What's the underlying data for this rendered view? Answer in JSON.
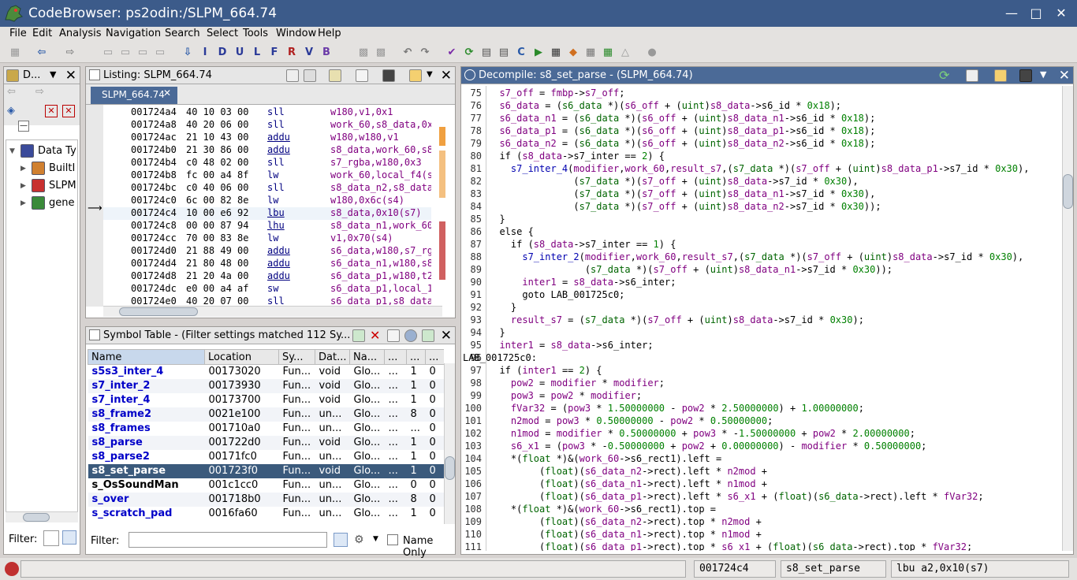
{
  "window": {
    "title": "CodeBrowser: ps2odin:/SLPM_664.74"
  },
  "menu": [
    "File",
    "Edit",
    "Analysis",
    "Navigation",
    "Search",
    "Select",
    "Tools",
    "Window",
    "Help"
  ],
  "toolbar_letters": [
    "I",
    "D",
    "U",
    "L",
    "F",
    "R",
    "V",
    "B"
  ],
  "datatypes": {
    "title": "D...",
    "items": [
      {
        "label": "Data Ty",
        "expanded": true
      },
      {
        "label": "BuiltI"
      },
      {
        "label": "SLPM"
      },
      {
        "label": "gene"
      }
    ],
    "filter_label": "Filter:"
  },
  "listing": {
    "title": "Listing:  SLPM_664.74",
    "tab": "SLPM_664.74",
    "rows": [
      {
        "addr": "001724a4",
        "bytes": "40 10 03 00",
        "mn": "sll",
        "op": "w180,v1,0x1"
      },
      {
        "addr": "001724a8",
        "bytes": "40 20 06 00",
        "mn": "sll",
        "op": "work_60,s8_data,0x"
      },
      {
        "addr": "001724ac",
        "bytes": "21 10 43 00",
        "mn": "addu",
        "op": "w180,w180,v1"
      },
      {
        "addr": "001724b0",
        "bytes": "21 30 86 00",
        "mn": "addu",
        "op": "s8_data,work_60,s8"
      },
      {
        "addr": "001724b4",
        "bytes": "c0 48 02 00",
        "mn": "sll",
        "op": "s7_rgba,w180,0x3"
      },
      {
        "addr": "001724b8",
        "bytes": "fc 00 a4 8f",
        "mn": "lw",
        "op": "work_60,local_f4(s"
      },
      {
        "addr": "001724bc",
        "bytes": "c0 40 06 00",
        "mn": "sll",
        "op": "s8_data_n2,s8_data"
      },
      {
        "addr": "001724c0",
        "bytes": "6c 00 82 8e",
        "mn": "lw",
        "op": "w180,0x6c(s4)"
      },
      {
        "addr": "001724c4",
        "bytes": "10 00 e6 92",
        "mn": "lbu",
        "op": "s8_data,0x10(s7)"
      },
      {
        "addr": "001724c8",
        "bytes": "00 00 87 94",
        "mn": "lhu",
        "op": "s8_data_n1,work_60"
      },
      {
        "addr": "001724cc",
        "bytes": "70 00 83 8e",
        "mn": "lw",
        "op": "v1,0x70(s4)"
      },
      {
        "addr": "001724d0",
        "bytes": "21 88 49 00",
        "mn": "addu",
        "op": "s6_data,w180,s7_rg"
      },
      {
        "addr": "001724d4",
        "bytes": "21 80 48 00",
        "mn": "addu",
        "op": "s6_data_n1,w180,s8"
      },
      {
        "addr": "001724d8",
        "bytes": "21 20 4a 00",
        "mn": "addu",
        "op": "s6_data_p1,w180,t2"
      },
      {
        "addr": "001724dc",
        "bytes": "e0 00 a4 af",
        "mn": "sw",
        "op": "s6_data_p1,local_1"
      },
      {
        "addr": "001724e0",
        "bytes": "40 20 07 00",
        "mn": "sll",
        "op": "s6_data_p1,s8_data"
      }
    ]
  },
  "symtab": {
    "title": "Symbol Table - (Filter settings matched 112 Sy...",
    "columns": [
      "Name",
      "Location",
      "Sy...",
      "Dat...",
      "Na...",
      "...",
      "...",
      "..."
    ],
    "rows": [
      [
        "s5s3_inter_4",
        "00173020",
        "Fun...",
        "void",
        "Glo...",
        "...",
        "1",
        "0"
      ],
      [
        "s7_inter_2",
        "00173930",
        "Fun...",
        "void",
        "Glo...",
        "...",
        "1",
        "0"
      ],
      [
        "s7_inter_4",
        "00173700",
        "Fun...",
        "void",
        "Glo...",
        "...",
        "1",
        "0"
      ],
      [
        "s8_frame2",
        "0021e100",
        "Fun...",
        "un...",
        "Glo...",
        "...",
        "8",
        "0"
      ],
      [
        "s8_frames",
        "001710a0",
        "Fun...",
        "un...",
        "Glo...",
        "...",
        "...",
        "0"
      ],
      [
        "s8_parse",
        "001722d0",
        "Fun...",
        "void",
        "Glo...",
        "...",
        "1",
        "0"
      ],
      [
        "s8_parse2",
        "00171fc0",
        "Fun...",
        "un...",
        "Glo...",
        "...",
        "1",
        "0"
      ],
      [
        "s8_set_parse",
        "001723f0",
        "Fun...",
        "void",
        "Glo...",
        "...",
        "1",
        "0"
      ],
      [
        "s_OsSoundMan",
        "001c1cc0",
        "Fun...",
        "un...",
        "Glo...",
        "...",
        "0",
        "0"
      ],
      [
        "s_over",
        "001718b0",
        "Fun...",
        "un...",
        "Glo...",
        "...",
        "8",
        "0"
      ],
      [
        "s_scratch_pad",
        "0016fa60",
        "Fun...",
        "un...",
        "Glo...",
        "...",
        "1",
        "0"
      ]
    ],
    "filter_label": "Filter:",
    "name_only": "Name Only"
  },
  "decompile": {
    "title": "Decompile: s8_set_parse -  (SLPM_664.74)",
    "lines": [
      {
        "n": "75",
        "c": "  s7_off = fmbp->s7_off;"
      },
      {
        "n": "76",
        "c": "  s6_data = (s6_data *)(s6_off + (uint)s8_data->s6_id * 0x18);"
      },
      {
        "n": "77",
        "c": "  s6_data_n1 = (s6_data *)(s6_off + (uint)s8_data_n1->s6_id * 0x18);"
      },
      {
        "n": "78",
        "c": "  s6_data_p1 = (s6_data *)(s6_off + (uint)s8_data_p1->s6_id * 0x18);"
      },
      {
        "n": "79",
        "c": "  s6_data_n2 = (s6_data *)(s6_off + (uint)s8_data_n2->s6_id * 0x18);"
      },
      {
        "n": "80",
        "c": "  if (s8_data->s7_inter == 2) {"
      },
      {
        "n": "81",
        "c": "    s7_inter_4(modifier,work_60,result_s7,(s7_data *)(s7_off + (uint)s8_data_p1->s7_id * 0x30),"
      },
      {
        "n": "82",
        "c": "               (s7_data *)(s7_off + (uint)s8_data->s7_id * 0x30),"
      },
      {
        "n": "83",
        "c": "               (s7_data *)(s7_off + (uint)s8_data_n1->s7_id * 0x30),"
      },
      {
        "n": "84",
        "c": "               (s7_data *)(s7_off + (uint)s8_data_n2->s7_id * 0x30));"
      },
      {
        "n": "85",
        "c": "  }"
      },
      {
        "n": "86",
        "c": "  else {"
      },
      {
        "n": "87",
        "c": "    if (s8_data->s7_inter == 1) {"
      },
      {
        "n": "88",
        "c": "      s7_inter_2(modifier,work_60,result_s7,(s7_data *)(s7_off + (uint)s8_data->s7_id * 0x30),"
      },
      {
        "n": "89",
        "c": "                 (s7_data *)(s7_off + (uint)s8_data_n1->s7_id * 0x30));"
      },
      {
        "n": "90",
        "c": "      inter1 = s8_data->s6_inter;"
      },
      {
        "n": "91",
        "c": "      goto LAB_001725c0;"
      },
      {
        "n": "92",
        "c": "    }"
      },
      {
        "n": "93",
        "c": "    result_s7 = (s7_data *)(s7_off + (uint)s8_data->s7_id * 0x30);"
      },
      {
        "n": "94",
        "c": "  }"
      },
      {
        "n": "95",
        "c": "  inter1 = s8_data->s6_inter;"
      },
      {
        "n": "96",
        "c": "LAB_001725c0:"
      },
      {
        "n": "97",
        "c": "  if (inter1 == 2) {"
      },
      {
        "n": "98",
        "c": "    pow2 = modifier * modifier;"
      },
      {
        "n": "99",
        "c": "    pow3 = pow2 * modifier;"
      },
      {
        "n": "100",
        "c": "    fVar32 = (pow3 * 1.50000000 - pow2 * 2.50000000) + 1.00000000;"
      },
      {
        "n": "101",
        "c": "    n2mod = pow3 * 0.50000000 - pow2 * 0.50000000;"
      },
      {
        "n": "102",
        "c": "    n1mod = modifier * 0.50000000 + pow3 * -1.50000000 + pow2 * 2.00000000;"
      },
      {
        "n": "103",
        "c": "    s6_x1 = (pow3 * -0.50000000 + pow2 + 0.00000000) - modifier * 0.50000000;"
      },
      {
        "n": "104",
        "c": "    *(float *)&(work_60->s6_rect1).left ="
      },
      {
        "n": "105",
        "c": "         (float)(s6_data_n2->rect).left * n2mod +"
      },
      {
        "n": "106",
        "c": "         (float)(s6_data_n1->rect).left * n1mod +"
      },
      {
        "n": "107",
        "c": "         (float)(s6_data_p1->rect).left * s6_x1 + (float)(s6_data->rect).left * fVar32;"
      },
      {
        "n": "108",
        "c": "    *(float *)&(work_60->s6_rect1).top ="
      },
      {
        "n": "109",
        "c": "         (float)(s6_data_n2->rect).top * n2mod +"
      },
      {
        "n": "110",
        "c": "         (float)(s6_data_n1->rect).top * n1mod +"
      },
      {
        "n": "111",
        "c": "         (float)(s6_data_p1->rect).top * s6_x1 + (float)(s6_data->rect).top * fVar32;"
      }
    ]
  },
  "status": {
    "addr": "001724c4",
    "func": "s8_set_parse",
    "instr": "lbu a2,0x10(s7)"
  },
  "colors": {
    "titlebar": "#3c5b8a",
    "active_head": "#4b6a97",
    "selection": "#3b5a7c"
  }
}
